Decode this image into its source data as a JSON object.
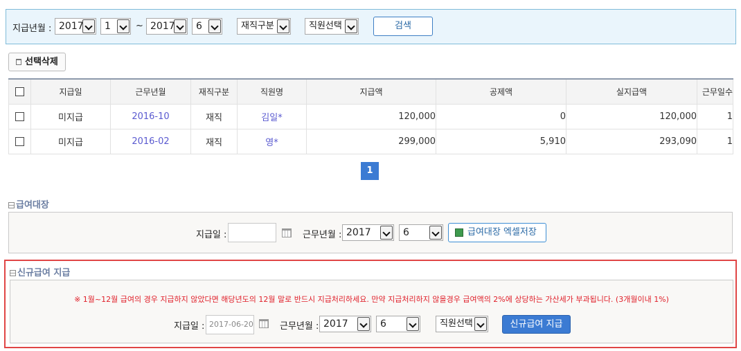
{
  "search": {
    "date_label": "지급년월 :",
    "from_year": "2017",
    "from_month": "1",
    "tilde": "~",
    "to_year": "2017",
    "to_month": "6",
    "status_select": "재직구분",
    "employee_select": "직원선택",
    "search_button": "검색"
  },
  "toolbar": {
    "delete_label": "선택삭제"
  },
  "table": {
    "headers": [
      "지급일",
      "근무년월",
      "재직구분",
      "직원명",
      "지급액",
      "공제액",
      "실지급액",
      "근무일수"
    ],
    "rows": [
      {
        "pay_date": "미지급",
        "work_month": "2016-10",
        "status": "재직",
        "name": "김일*",
        "pay": "120,000",
        "deduction": "0",
        "net": "120,000",
        "days": "1"
      },
      {
        "pay_date": "미지급",
        "work_month": "2016-02",
        "status": "재직",
        "name": "영*",
        "pay": "299,000",
        "deduction": "5,910",
        "net": "293,090",
        "days": "1"
      }
    ]
  },
  "pagination": {
    "current": "1"
  },
  "payroll": {
    "title": "급여대장",
    "pay_date_label": "지급일 :",
    "pay_date_value": "",
    "work_month_label": "근무년월 :",
    "year": "2017",
    "month": "6",
    "excel_button": "급여대장 엑셀저장"
  },
  "new_pay": {
    "title": "신규급여 지급",
    "notice": "※ 1월~12월 급여의 경우 지급하지 않았다면 해당년도의 12월 말로 반드시 지급처리하세요. 만약 지급처리하지 않을경우 급여액의 2%에 상당하는 가산세가 부과됩니다. (3개월이내 1%)",
    "pay_date_label": "지급일 :",
    "pay_date_value": "2017-06-20",
    "work_month_label": "근무년월 :",
    "year": "2017",
    "month": "6",
    "employee_select": "직원선택",
    "submit_button": "신규급여 지급"
  },
  "colors": {
    "accent": "#3b7bd3",
    "search_bg": "#eaf5fc",
    "alert_border": "#e04545",
    "notice_text": "#e0202a"
  }
}
